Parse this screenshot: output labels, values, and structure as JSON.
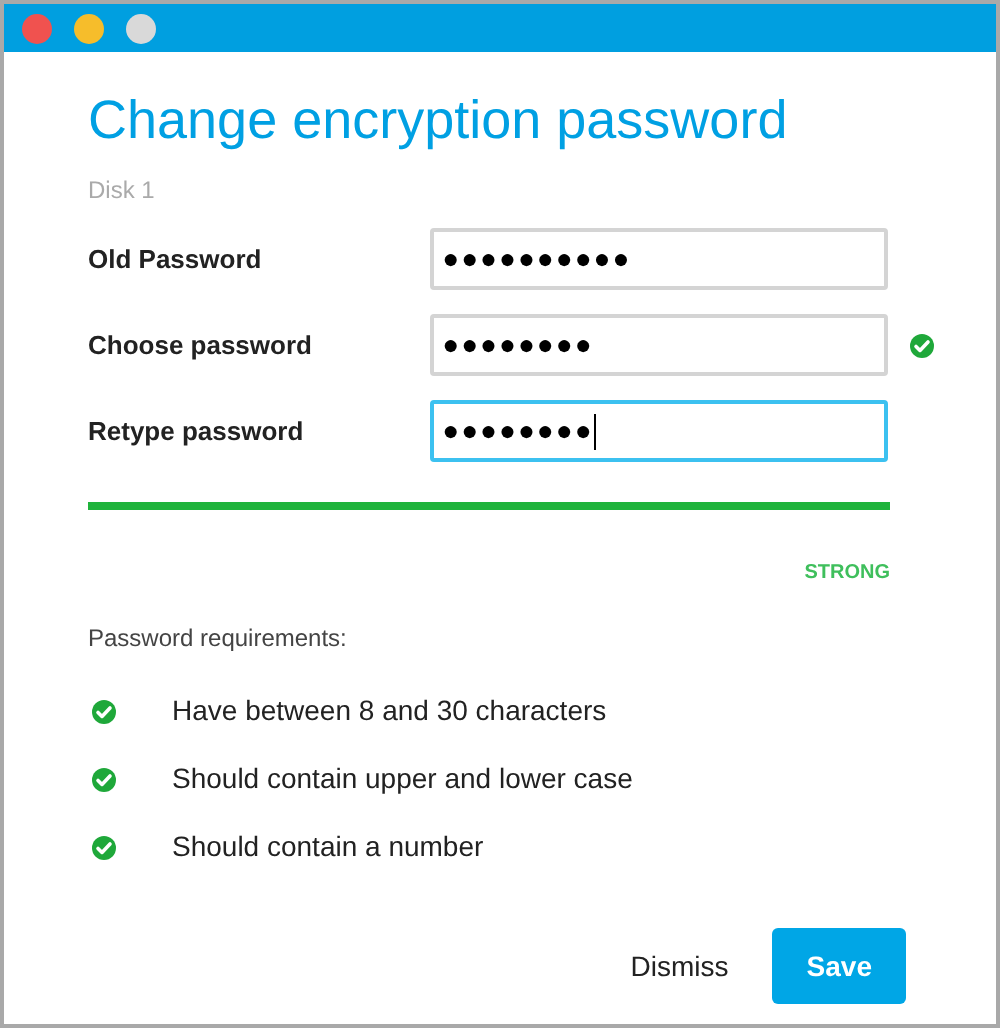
{
  "window": {
    "controls": [
      {
        "kind": "close"
      },
      {
        "kind": "minimize"
      },
      {
        "kind": "zoom"
      }
    ]
  },
  "title": "Change encryption password",
  "subtitle": "Disk 1",
  "fields": [
    {
      "label": "Old Password",
      "value": "●●●●●●●●●●",
      "focused": false,
      "valid": false
    },
    {
      "label": "Choose password",
      "value": "●●●●●●●●",
      "focused": false,
      "valid": true
    },
    {
      "label": "Retype password",
      "value": "●●●●●●●●",
      "focused": true,
      "valid": false
    }
  ],
  "strength": {
    "level": 1,
    "label": "STRONG"
  },
  "requirements": {
    "heading": "Password requirements:",
    "items": [
      {
        "text": "Have between 8 and 30 characters",
        "met": true
      },
      {
        "text": "Should contain upper and lower case",
        "met": true
      },
      {
        "text": "Should contain a number",
        "met": true
      }
    ]
  },
  "buttons": [
    {
      "label": "Dismiss",
      "kind": "secondary"
    },
    {
      "label": "Save",
      "kind": "primary"
    }
  ]
}
